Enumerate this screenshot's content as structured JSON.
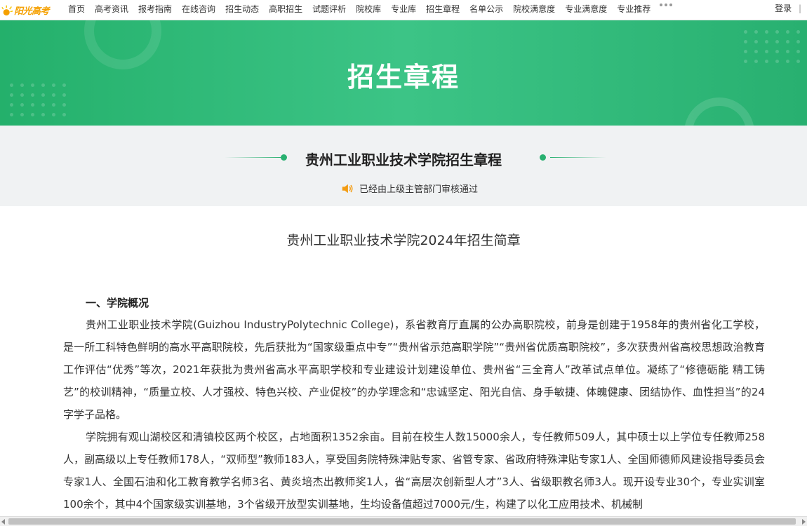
{
  "site": {
    "logo_text": "阳光高考",
    "nav": [
      "首页",
      "高考资讯",
      "报考指南",
      "在线咨询",
      "招生动态",
      "高职招生",
      "试题评析",
      "院校库",
      "专业库",
      "招生章程",
      "名单公示",
      "院校满意度",
      "专业满意度",
      "专业推荐"
    ],
    "login_label": "登录",
    "login_sep": "|"
  },
  "banner": {
    "title": "招生章程"
  },
  "subheader": {
    "title": "贵州工业职业技术学院招生章程",
    "audit_text": "已经由上级主管部门审核通过"
  },
  "document": {
    "title": "贵州工业职业技术学院2024年招生简章",
    "section1_heading": "一、学院概况",
    "para1": "贵州工业职业技术学院(Guizhou IndustryPolytechnic College)，系省教育厅直属的公办高职院校，前身是创建于1958年的贵州省化工学校，是一所工科特色鲜明的高水平高职院校，先后获批为“国家级重点中专”“贵州省示范高职学院”“贵州省优质高职院校”，多次获贵州省高校思想政治教育工作评估“优秀”等次，2021年获批为贵州省高水平高职学校和专业建设计划建设单位、贵州省“三全育人”改革试点单位。凝练了“修德砺能 精工铸艺”的校训精神，“质量立校、人才强校、特色兴校、产业促校”的办学理念和“忠诚坚定、阳光自信、身手敏捷、体魄健康、团结协作、血性担当”的24字学子品格。",
    "para2": "学院拥有观山湖校区和清镇校区两个校区，占地面积1352余亩。目前在校生人数15000余人，专任教师509人，其中硕士以上学位专任教师258人，副高级以上专任教师178人，“双师型”教师183人，享受国务院特殊津贴专家、省管专家、省政府特殊津贴专家1人、全国师德师风建设指导委员会专家1人、全国石油和化工教育教学名师3名、黄炎培杰出教师奖1人，省“高层次创新型人才”3人、省级职教名师3人。现开设专业30个，专业实训室100余个，其中4个国家级实训基地，3个省级开放型实训基地，生均设备值超过7000元/生，构建了以化工应用技术、机械制"
  },
  "colors": {
    "brand_green": "#28b070",
    "logo_orange": "#f5a000",
    "speaker_orange": "#f39c12"
  }
}
